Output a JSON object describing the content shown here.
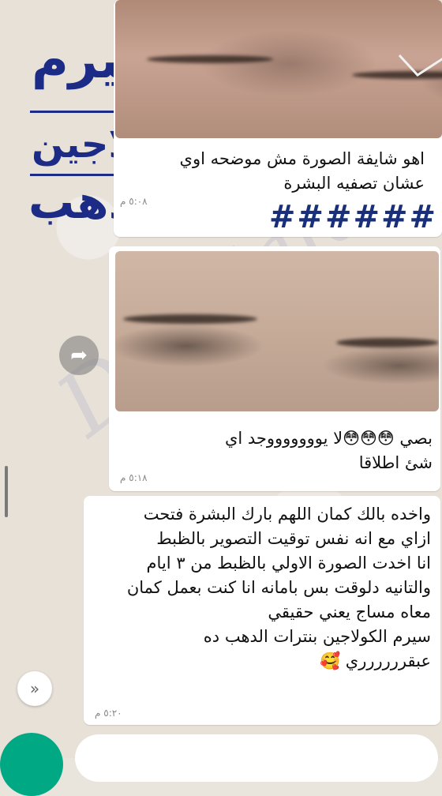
{
  "brand": {
    "line1": "سيرم",
    "line2": "كولاجين",
    "line3": "الدهب",
    "color": "#1c2b86"
  },
  "messages": [
    {
      "text": "اهو شايفة الصورة مش موضحه اوي\nعشان تصفيه البشرة",
      "time": "٥:٠٨ م"
    },
    {
      "hashes": "######"
    },
    {
      "text": "بصي 😳😳😳لا يوووووووجد اي\nشئ اطلاقا",
      "time": "٥:١٨ م"
    },
    {
      "text": "واخده بالك كمان اللهم بارك البشرة فتحت\nازاي مع انه نفس توقيت التصوير بالظبط\nانا اخدت الصورة الاولي بالظبط من ٣ ايام\nوالتانيه دلوقت بس بامانه انا كنت بعمل كمان\nمعاه مساج يعني حقيقي\nسيرم الكولاجين بنترات الدهب ده\nعبقرررررري 🥰",
      "time": "٥:٢٠ م"
    }
  ],
  "watermark": "Dr. Hala",
  "icons": {
    "forward": "forward-icon",
    "scroll_down": "chevron-double-down-icon",
    "check": "checkmark-icon"
  },
  "colors": {
    "accent": "#00a884",
    "bubble": "#ffffff",
    "wallpaper": "#e7e1d8"
  }
}
